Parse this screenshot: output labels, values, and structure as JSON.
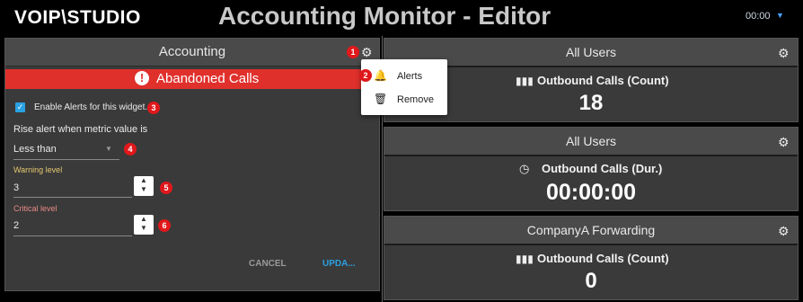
{
  "header": {
    "logo": "VOIP\\STUDIO",
    "title": "Accounting Monitor - Editor",
    "clock": "00:00"
  },
  "editor": {
    "panel_title": "Accounting",
    "banner": "Abandoned Calls",
    "enable_alerts_label": "Enable Alerts for this widget.",
    "rise_alert_label": "Rise alert when metric value is",
    "comparison_value": "Less than",
    "warning_label": "Warning level",
    "warning_value": "3",
    "critical_label": "Critical level",
    "critical_value": "2",
    "cancel_label": "CANCEL",
    "update_label": "UPDA..."
  },
  "menu": {
    "items": [
      {
        "label": "Alerts",
        "icon": "bell-icon"
      },
      {
        "label": "Remove",
        "icon": "trash-icon"
      }
    ]
  },
  "widgets": [
    {
      "title": "All Users",
      "metric": "Outbound Calls (Count)",
      "value": "18",
      "icon": "bar-chart-icon"
    },
    {
      "title": "All Users",
      "metric": "Outbound Calls (Dur.)",
      "value": "00:00:00",
      "icon": "clock-icon"
    },
    {
      "title": "CompanyA Forwarding",
      "metric": "Outbound Calls (Count)",
      "value": "0",
      "icon": "bar-chart-icon"
    }
  ],
  "badges": [
    "1",
    "2",
    "3",
    "4",
    "5",
    "6"
  ],
  "colors": {
    "banner": "#e0302c",
    "accent": "#2aa1e2",
    "badge": "#e0181b",
    "warning_label": "#e6c870",
    "critical_label": "#e88a86"
  }
}
